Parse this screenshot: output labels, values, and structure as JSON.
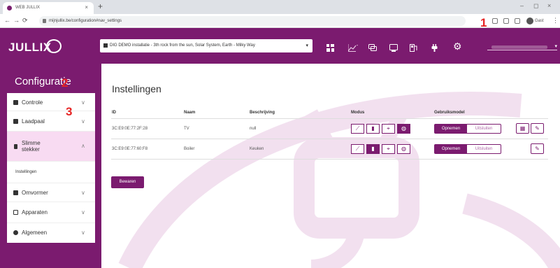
{
  "browser": {
    "tab_title": "WEB JULLIX",
    "tab_close": "×",
    "new_tab": "+",
    "url": "mijnjullix.be/configuration#nav_settings",
    "profile_label": "Gast",
    "window_controls": [
      "–",
      "◻",
      "×"
    ]
  },
  "header": {
    "logo": "JULLIX",
    "location": "DIG DEMO installatie - 3th rock from the sun, Solar System, Earth - Milky Way",
    "location_caret": "▾",
    "user_caret": "▾"
  },
  "annotations": {
    "one": "1",
    "two": "2",
    "three": "3"
  },
  "sidebar": {
    "title": "Configuratie",
    "chevron_down": "∨",
    "chevron_up": "∧",
    "items": [
      {
        "label": "Controle",
        "icon": "chart-icon"
      },
      {
        "label": "Laadpaal",
        "icon": "charger-icon"
      },
      {
        "label": "Slimme stekker",
        "icon": "plug-icon",
        "expanded": true
      },
      {
        "label": "Omvormer",
        "icon": "inverter-icon"
      },
      {
        "label": "Apparaten",
        "icon": "devices-icon"
      },
      {
        "label": "Algemeen",
        "icon": "gear-icon"
      }
    ],
    "subitem": "Instellingen"
  },
  "main": {
    "title": "Instellingen",
    "columns": [
      "ID",
      "Naam",
      "Beschrijving",
      "Modus",
      "Gebruiksmodel"
    ],
    "rows": [
      {
        "id": "3C:E9:0E:77:2F:28",
        "name": "TV",
        "description": "null",
        "active_mode": 3
      },
      {
        "id": "3C:E9:0E:77:60:F8",
        "name": "Boiler",
        "description": "Keuken",
        "active_mode": 1
      }
    ],
    "usage_on": "Opnemen",
    "usage_off": "Uitsluiten",
    "save": "Bewaren"
  },
  "colors": {
    "brand": "#7b1b6f",
    "active_menu": "#f8dbf2",
    "annotation": "#e62424"
  }
}
